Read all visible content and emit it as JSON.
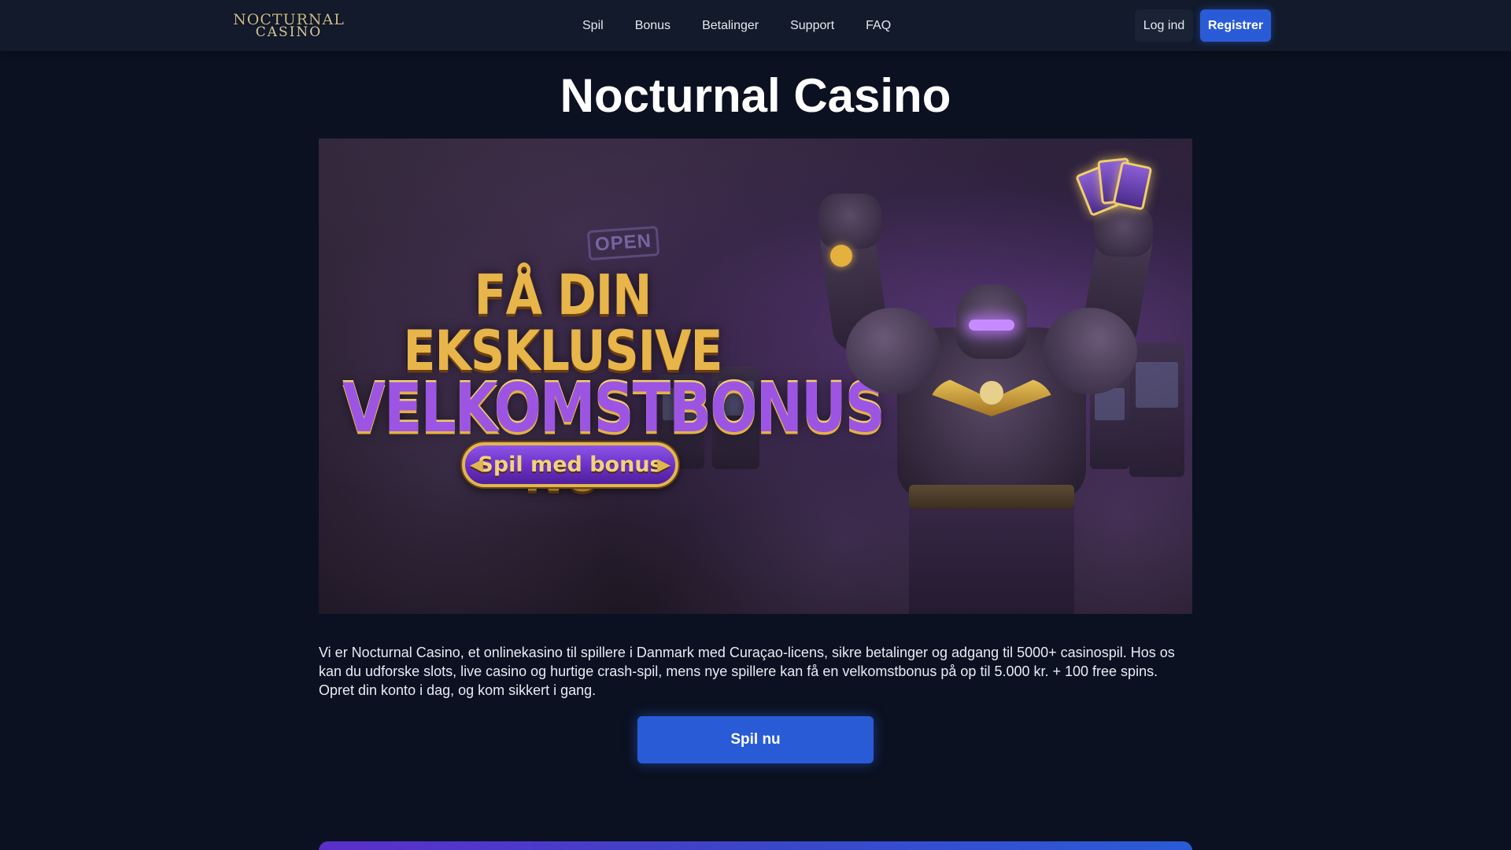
{
  "header": {
    "logo_line1": "NOCTURNAL",
    "logo_line2": "CASINO",
    "nav": [
      "Spil",
      "Bonus",
      "Betalinger",
      "Support",
      "FAQ"
    ],
    "login_label": "Log ind",
    "register_label": "Registrer"
  },
  "main": {
    "title": "Nocturnal Casino",
    "banner": {
      "headline_line1": "FÅ DIN EKSKLUSIVE",
      "headline_line2": "VELKOMSTBONUS",
      "headline_line3": "NU",
      "button_label": "Spil med bonus",
      "sign_open": "OPEN"
    },
    "description": "Vi er Nocturnal Casino, et onlinekasino til spillere i Danmark med Curaçao-licens, sikre betalinger og adgang til 5000+ casinospil. Hos os kan du udforske slots, live casino og hurtige crash-spil, mens nye spillere kan få en velkomstbonus på op til 5.000 kr. + 100 free spins. Opret din konto i dag, og kom sikkert i gang.",
    "play_button_label": "Spil nu"
  },
  "colors": {
    "background": "#0b1120",
    "header": "#121a2b",
    "primary": "#2a5bd7",
    "gold": "#e8b54a",
    "purple": "#9c55e3"
  }
}
